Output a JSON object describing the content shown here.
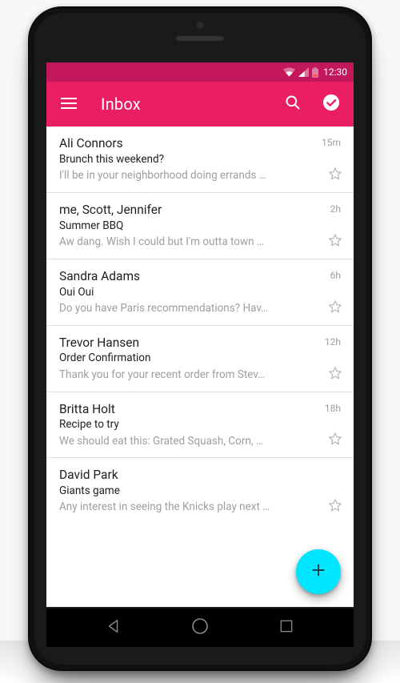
{
  "status": {
    "time": "12:30"
  },
  "appbar": {
    "title": "Inbox"
  },
  "emails": [
    {
      "sender": "Ali Connors",
      "subject": "Brunch this weekend?",
      "preview": "I'll be in your neighborhood doing errands …",
      "time": "15m"
    },
    {
      "sender": "me, Scott, Jennifer",
      "subject": "Summer BBQ",
      "preview": "Aw dang. Wish I could but I'm outta town …",
      "time": "2h"
    },
    {
      "sender": "Sandra Adams",
      "subject": "Oui Oui",
      "preview": "Do you have Paris recommendations? Hav…",
      "time": "6h"
    },
    {
      "sender": "Trevor Hansen",
      "subject": "Order Confirmation",
      "preview": "Thank you for your recent order from Stev…",
      "time": "12h"
    },
    {
      "sender": "Britta Holt",
      "subject": "Recipe to try",
      "preview": "We should eat this: Grated Squash, Corn, …",
      "time": "18h"
    },
    {
      "sender": "David Park",
      "subject": "Giants game",
      "preview": "Any interest in seeing the Knicks play next …",
      "time": ""
    }
  ]
}
